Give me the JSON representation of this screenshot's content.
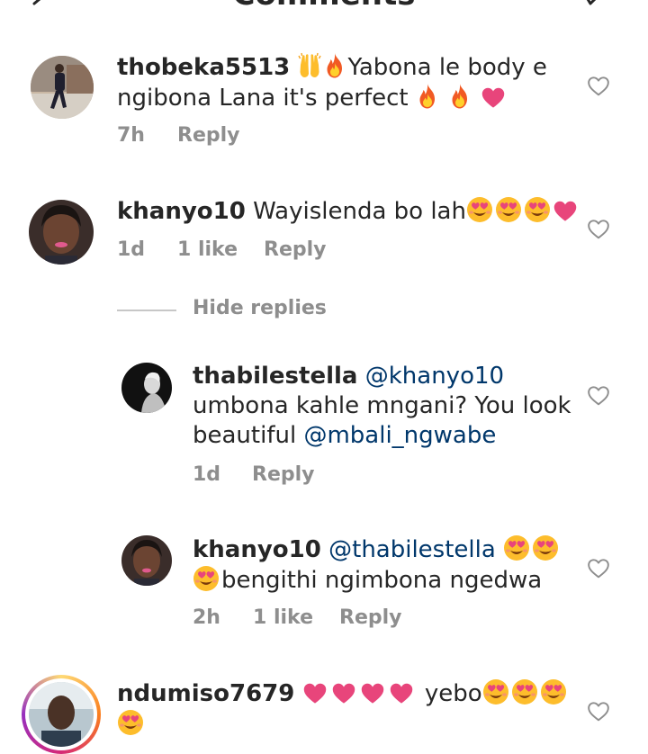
{
  "header": {
    "title": "Comments"
  },
  "comments": [
    {
      "username": "thobeka5513",
      "text_line1": "Yabona le body e",
      "text_line2": "ngibona Lana it's perfect",
      "time": "7h",
      "reply_label": "Reply"
    },
    {
      "username": "khanyo10",
      "text": "Wayislenda bo lah",
      "time": "1d",
      "likes": "1 like",
      "reply_label": "Reply"
    }
  ],
  "hide_replies_label": "Hide replies",
  "replies": [
    {
      "username": "thabilestella",
      "mention": "@khanyo10",
      "text_line2": "umbona kahle mngani? You look",
      "text_line3_prefix": "beautiful",
      "mention2": "@mbali_ngwabe",
      "time": "1d",
      "reply_label": "Reply"
    },
    {
      "username": "khanyo10",
      "mention": "@thabilestella",
      "text_line2": "bengithi ngimbona ngedwa",
      "time": "2h",
      "likes": "1 like",
      "reply_label": "Reply"
    }
  ],
  "last_comment": {
    "username": "ndumiso7679",
    "text": "yebo"
  },
  "colors": {
    "text": "#262626",
    "meta": "#8e8e8e",
    "mention": "#00376b",
    "heart_emoji": "#e8457b",
    "story_ring": "#d62976"
  }
}
